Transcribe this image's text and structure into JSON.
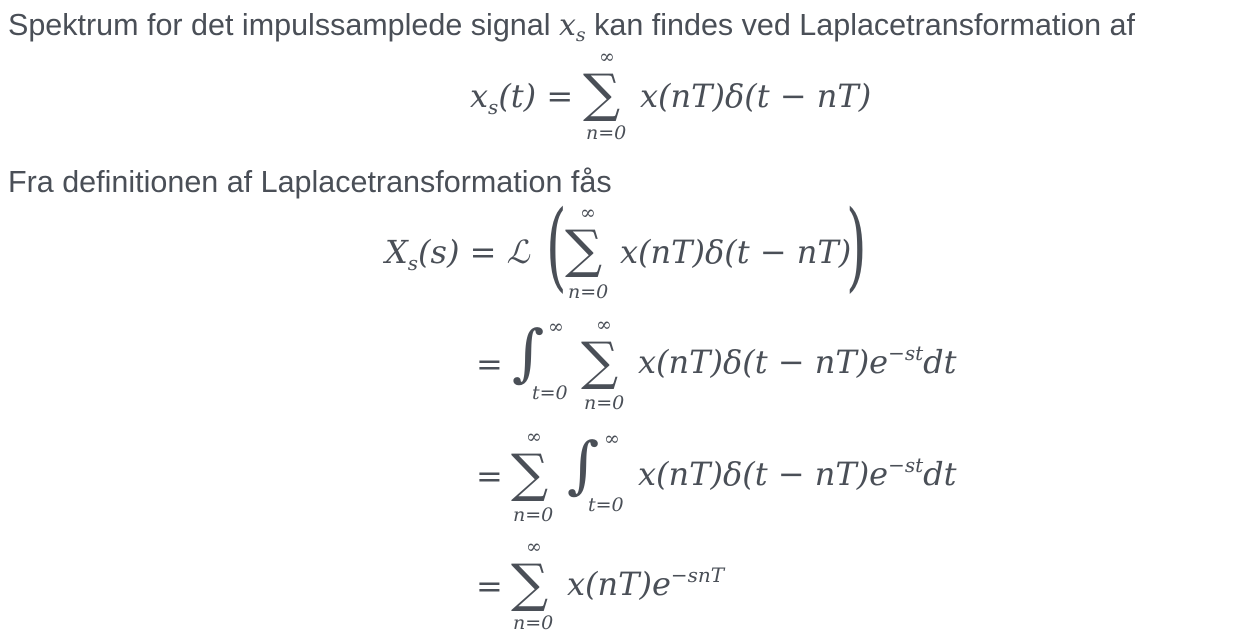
{
  "paragraph1": {
    "text_before": "Spektrum for det impulssamplede signal",
    "inline_symbol": "x",
    "inline_sub": "s",
    "text_after": "kan findes ved Laplacetransformation af"
  },
  "eq1": {
    "lhs": "x",
    "lhs_sub": "s",
    "lhs_arg": "(t) =",
    "sum_symbol": "∑",
    "sum_upper": "∞",
    "sum_lower": "n=0",
    "body": "x(nT)δ(t − nT)"
  },
  "paragraph2": {
    "text": "Fra definitionen af Laplacetransformation fås"
  },
  "eq2": {
    "line1": {
      "lhs": "X",
      "lhs_sub": "s",
      "lhs_arg": "(s) = ℒ",
      "open_paren": "(",
      "close_paren": ")",
      "sum_symbol": "∑",
      "sum_upper": "∞",
      "sum_lower": "n=0",
      "body": "x(nT)δ(t − nT)"
    },
    "line2": {
      "eq": "=",
      "int_symbol": "∫",
      "int_upper": "∞",
      "int_lower": "t=0",
      "sum_symbol": "∑",
      "sum_upper": "∞",
      "sum_lower": "n=0",
      "body": "x(nT)δ(t − nT)e",
      "exp": "−st",
      "tail": "dt"
    },
    "line3": {
      "eq": "=",
      "sum_symbol": "∑",
      "sum_upper": "∞",
      "sum_lower": "n=0",
      "int_symbol": "∫",
      "int_upper": "∞",
      "int_lower": "t=0",
      "body": "x(nT)δ(t − nT)e",
      "exp": "−st",
      "tail": "dt"
    },
    "line4": {
      "eq": "=",
      "sum_symbol": "∑",
      "sum_upper": "∞",
      "sum_lower": "n=0",
      "body": "x(nT)e",
      "exp": "−snT"
    }
  }
}
